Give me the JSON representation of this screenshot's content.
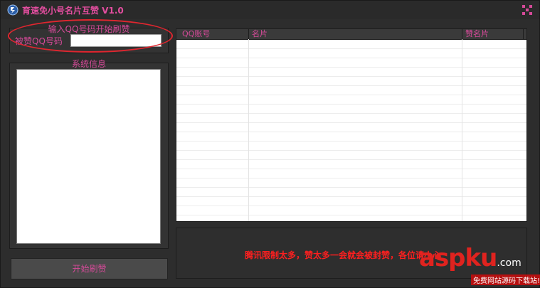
{
  "window": {
    "title": "育速免小号名片互赞 V1.0"
  },
  "input_group": {
    "caption": "输入QQ号码开始刷赞",
    "qq_label": "被赞QQ号码",
    "qq_value": "",
    "qq_placeholder": ""
  },
  "sysinfo": {
    "caption": "系统信息",
    "content": ""
  },
  "start_button": {
    "label": "开始刷赞"
  },
  "table": {
    "columns": [
      "QQ账号",
      "名片",
      "赞名片"
    ],
    "rows": []
  },
  "notice": {
    "text": "腾讯限制太多，赞太多一会就会被封赞，各位请小心"
  },
  "watermark": {
    "logo_asp": "asp",
    "logo_ku": "ku",
    "logo_com": ".com",
    "sub": "免费网站源码下载站!"
  },
  "colors": {
    "accent": "#d64a99",
    "warning": "#ff1f1f",
    "highlight_oval": "#e0262f"
  },
  "icons": {
    "app": "app-icon",
    "window_button": "window-control-icon"
  }
}
